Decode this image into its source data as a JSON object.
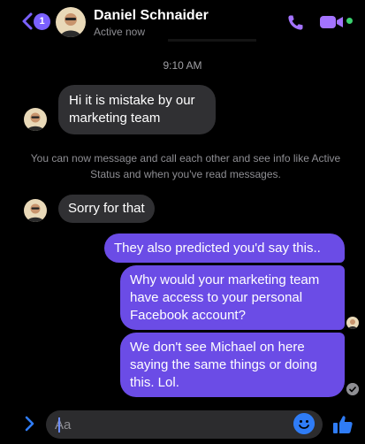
{
  "header": {
    "unread_count": "1",
    "contact_name": "Daniel Schnaider",
    "status": "Active now"
  },
  "conversation": {
    "timestamp": "9:10 AM",
    "messages": [
      {
        "from": "them",
        "text": "Hi it is mistake by our marketing team"
      },
      {
        "from": "them",
        "text": "Sorry for that"
      },
      {
        "from": "me",
        "text": "They also predicted you'd say this.."
      },
      {
        "from": "me",
        "text": "Why would your marketing team have access to your personal Facebook account?"
      },
      {
        "from": "me",
        "text": "We don't see Michael on here saying the same things or doing this. Lol."
      }
    ],
    "system_notice": "You can now message and call each other and see info like Active Status and when you've read messages."
  },
  "composer": {
    "placeholder": "Aa"
  },
  "colors": {
    "accent": "#7b61ff",
    "outgoing_bubble": "#6b4ce6",
    "incoming_bubble": "#303033",
    "active": "#3bd16f",
    "like": "#2f7cf6"
  },
  "icons": {
    "back": "chevron-left-icon",
    "call": "phone-icon",
    "video": "video-camera-icon",
    "expand": "chevron-right-icon",
    "emoji": "emoji-icon",
    "like": "thumbs-up-icon",
    "read": "checkmark-icon"
  }
}
